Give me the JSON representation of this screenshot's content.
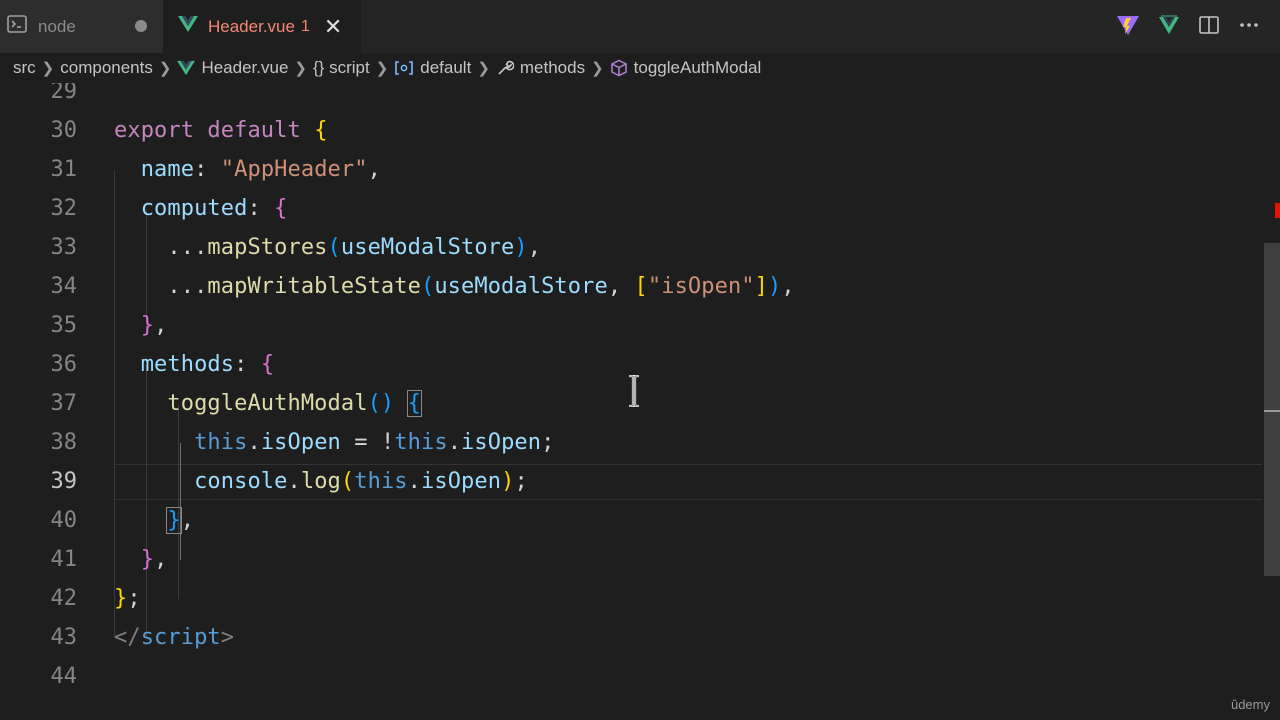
{
  "tabs": [
    {
      "label": "node",
      "icon": "terminal-icon",
      "dirty": true
    },
    {
      "label": "Header.vue",
      "badge": "1",
      "icon": "vue-icon",
      "active": true
    }
  ],
  "breadcrumb": [
    "src",
    "components",
    "Header.vue",
    "{} script",
    "default",
    "methods",
    "toggleAuthModal"
  ],
  "editor": {
    "active_line": 39,
    "line_numbers": [
      "29",
      "30",
      "31",
      "32",
      "33",
      "34",
      "35",
      "36",
      "37",
      "38",
      "39",
      "40",
      "41",
      "42",
      "43",
      "44"
    ],
    "lines": {
      "l30": {
        "a": "export default",
        "b": " ",
        "c": "{"
      },
      "l31": {
        "a": "  ",
        "b": "name",
        "c": ": ",
        "d": "\"AppHeader\"",
        "e": ","
      },
      "l32": {
        "a": "  ",
        "b": "computed",
        "c": ": ",
        "d": "{"
      },
      "l33": {
        "a": "    ...",
        "b": "mapStores",
        "c": "(",
        "d": "useModalStore",
        "e": ")",
        "f": ","
      },
      "l34": {
        "a": "    ...",
        "b": "mapWritableState",
        "c": "(",
        "d": "useModalStore",
        "e": ", ",
        "f": "[",
        "g": "\"isOpen\"",
        "h": "]",
        "i": ")",
        "j": ","
      },
      "l35": {
        "a": "  ",
        "b": "}",
        "c": ","
      },
      "l36": {
        "a": "  ",
        "b": "methods",
        "c": ": ",
        "d": "{"
      },
      "l37": {
        "a": "    ",
        "b": "toggleAuthModal",
        "c": "()",
        "d": " ",
        "e": "{"
      },
      "l38": {
        "a": "      ",
        "b": "this",
        "c": ".",
        "d": "isOpen",
        "e": " = !",
        "f": "this",
        "g": ".",
        "h": "isOpen",
        "i": ";"
      },
      "l39": {
        "a": "      ",
        "b": "console",
        "c": ".",
        "d": "log",
        "e": "(",
        "f": "this",
        "g": ".",
        "h": "isOpen",
        "i": ")",
        "j": ";"
      },
      "l40": {
        "a": "    ",
        "b": "}",
        "c": ","
      },
      "l41": {
        "a": "  ",
        "b": "}",
        "c": ","
      },
      "l42": {
        "a": "}",
        "b": ";"
      },
      "l43": {
        "a": "</",
        "b": "script",
        "c": ">"
      }
    }
  },
  "watermark": "ûdemy",
  "colors": {
    "keyword": "#c586c0",
    "property": "#9cdcfe",
    "string": "#ce9178",
    "function": "#dcdcaa",
    "this": "#569cd6",
    "bracket_1": "#ffd700",
    "bracket_2": "#da70d6",
    "bracket_3": "#179fff",
    "dirty_tab": "#f48771",
    "error_marker": "#e51400"
  }
}
